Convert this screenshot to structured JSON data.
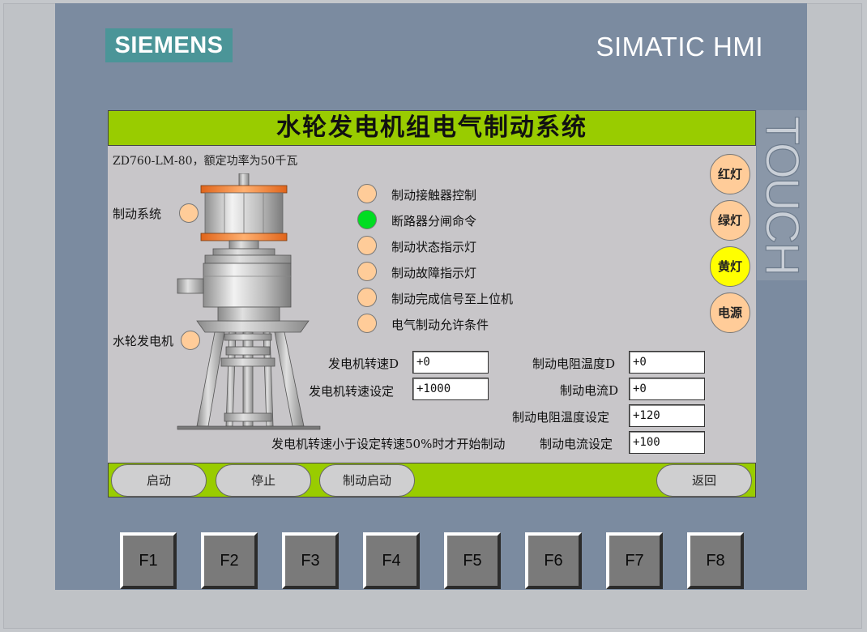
{
  "panel": {
    "brand_logo": "SIEMENS",
    "product_name": "SIMATIC HMI",
    "touch_label": "TOUCH",
    "colors": {
      "bezel": "#7b8ba0",
      "logo_bg": "#4b9598",
      "screen_bg": "#c8c6c9",
      "bar_green": "#99cc00"
    }
  },
  "screen": {
    "title": "水轮发电机组电气制动系统",
    "model_text": "ZD760-LM-80，额定功率为50千瓦",
    "brake_system_label": "制动系统",
    "generator_label": "水轮发电机",
    "indicators": [
      {
        "label": "制动接触器控制",
        "color": "#ffcc99"
      },
      {
        "label": "断路器分闸命令",
        "color": "#00dd22"
      },
      {
        "label": "制动状态指示灯",
        "color": "#ffcc99"
      },
      {
        "label": "制动故障指示灯",
        "color": "#ffcc99"
      },
      {
        "label": "制动完成信号至上位机",
        "color": "#ffcc99"
      },
      {
        "label": "电气制动允许条件",
        "color": "#ffcc99"
      }
    ],
    "right_buttons": [
      {
        "label": "红灯",
        "color": "#ffcc99"
      },
      {
        "label": "绿灯",
        "color": "#ffcc99"
      },
      {
        "label": "黄灯",
        "color": "#ffff00"
      },
      {
        "label": "电源",
        "color": "#ffcc99"
      }
    ],
    "fields": {
      "gen_speed_label": "发电机转速D",
      "gen_speed_value": "+0",
      "gen_speed_set_label": "发电机转速设定",
      "gen_speed_set_value": "+1000",
      "res_temp_label": "制动电阻温度D",
      "res_temp_value": "+0",
      "current_label": "制动电流D",
      "current_value": "+0",
      "res_temp_set_label": "制动电阻温度设定",
      "res_temp_set_value": "+120",
      "current_set_label": "制动电流设定",
      "current_set_value": "+100"
    },
    "note": "发电机转速小于设定转速50%时才开始制动",
    "bottom_buttons": {
      "start": "启动",
      "stop": "停止",
      "brake_start": "制动启动",
      "back": "返回"
    }
  },
  "function_keys": [
    "F1",
    "F2",
    "F3",
    "F4",
    "F5",
    "F6",
    "F7",
    "F8"
  ]
}
